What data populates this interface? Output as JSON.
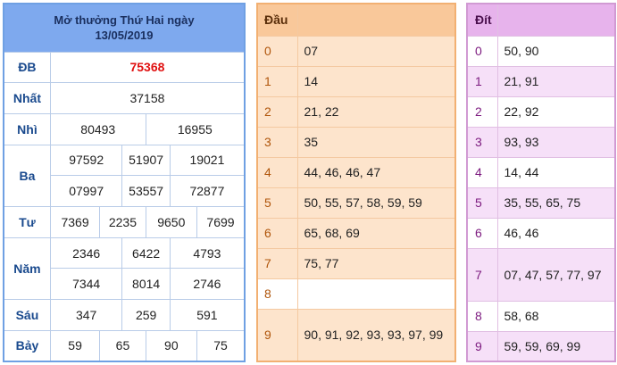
{
  "results": {
    "title_line1": "Mở thưởng Thứ Hai ngày",
    "title_line2": "13/05/2019",
    "rows": {
      "db": {
        "label": "ĐB",
        "values": [
          "75368"
        ]
      },
      "nhat": {
        "label": "Nhất",
        "values": [
          "37158"
        ]
      },
      "nhi": {
        "label": "Nhì",
        "values": [
          "80493",
          "16955"
        ]
      },
      "ba": {
        "label": "Ba",
        "values": [
          "97592",
          "51907",
          "19021",
          "07997",
          "53557",
          "72877"
        ]
      },
      "tu": {
        "label": "Tư",
        "values": [
          "7369",
          "2235",
          "9650",
          "7699"
        ]
      },
      "nam": {
        "label": "Năm",
        "values": [
          "2346",
          "6422",
          "4793",
          "7344",
          "8014",
          "2746"
        ]
      },
      "sau": {
        "label": "Sáu",
        "values": [
          "347",
          "259",
          "591"
        ]
      },
      "bay": {
        "label": "Bảy",
        "values": [
          "59",
          "65",
          "90",
          "75"
        ]
      }
    }
  },
  "dau": {
    "header": "Đầu",
    "rows": [
      {
        "key": "0",
        "value": "07"
      },
      {
        "key": "1",
        "value": "14"
      },
      {
        "key": "2",
        "value": "21, 22"
      },
      {
        "key": "3",
        "value": "35"
      },
      {
        "key": "4",
        "value": "44, 46, 46, 47"
      },
      {
        "key": "5",
        "value": "50, 55, 57, 58, 59, 59"
      },
      {
        "key": "6",
        "value": "65, 68, 69"
      },
      {
        "key": "7",
        "value": "75, 77"
      },
      {
        "key": "8",
        "value": ""
      },
      {
        "key": "9",
        "value": "90, 91, 92, 93, 93, 97, 99"
      }
    ]
  },
  "dit": {
    "header": "Đít",
    "rows": [
      {
        "key": "0",
        "value": "50, 90"
      },
      {
        "key": "1",
        "value": "21, 91"
      },
      {
        "key": "2",
        "value": "22, 92"
      },
      {
        "key": "3",
        "value": "93, 93"
      },
      {
        "key": "4",
        "value": "14, 44"
      },
      {
        "key": "5",
        "value": "35, 55, 65, 75"
      },
      {
        "key": "6",
        "value": "46, 46"
      },
      {
        "key": "7",
        "value": "07, 47, 57, 77, 97"
      },
      {
        "key": "8",
        "value": "58, 68"
      },
      {
        "key": "9",
        "value": "59, 59, 69, 99"
      }
    ]
  }
}
